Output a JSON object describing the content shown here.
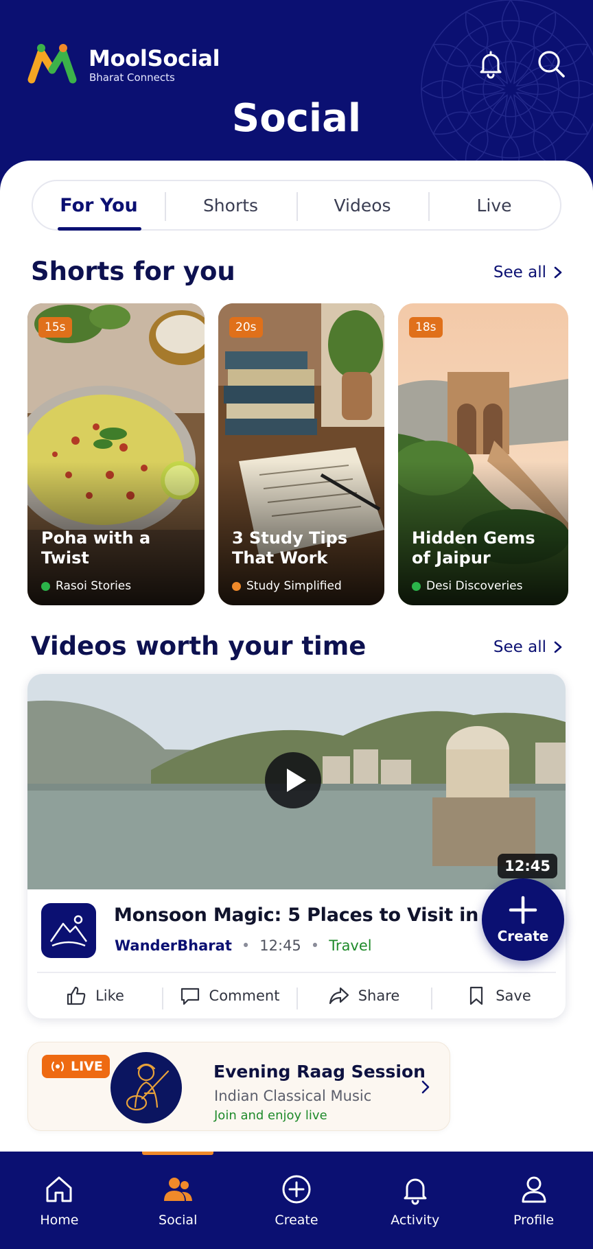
{
  "brand": {
    "name": "MoolSocial",
    "tagline": "Bharat Connects"
  },
  "header": {
    "title": "Social"
  },
  "tabs": [
    {
      "label": "For You",
      "active": true
    },
    {
      "label": "Shorts",
      "active": false
    },
    {
      "label": "Videos",
      "active": false
    },
    {
      "label": "Live",
      "active": false
    }
  ],
  "shorts_section": {
    "title": "Shorts for you",
    "see_all": "See all",
    "items": [
      {
        "duration": "15s",
        "title": "Poha with a Twist",
        "channel": "Rasoi Stories",
        "dot_color": "#2bb34a"
      },
      {
        "duration": "20s",
        "title": "3 Study Tips That Work",
        "channel": "Study Simplified",
        "dot_color": "#f08a2a"
      },
      {
        "duration": "18s",
        "title": "Hidden Gems of Jaipur",
        "channel": "Desi Discoveries",
        "dot_color": "#2bb34a"
      }
    ]
  },
  "videos_section": {
    "title": "Videos worth your time",
    "see_all": "See all",
    "video": {
      "duration": "12:45",
      "title": "Monsoon Magic: 5 Places to Visit in India",
      "channel": "WanderBharat",
      "length": "12:45",
      "category": "Travel",
      "separator": "•"
    },
    "actions": {
      "like": "Like",
      "comment": "Comment",
      "share": "Share",
      "save": "Save"
    }
  },
  "live": {
    "badge": "LIVE",
    "title": "Evening Raag Session",
    "subtitle": "Indian Classical Music",
    "cta": "Join and enjoy live"
  },
  "fab": {
    "label": "Create"
  },
  "nav": {
    "home": "Home",
    "social": "Social",
    "create": "Create",
    "activity": "Activity",
    "profile": "Profile"
  },
  "colors": {
    "primary": "#0b1072",
    "accent_orange": "#ee6a12",
    "accent_green": "#1e8a2a",
    "background": "#ffffff"
  }
}
